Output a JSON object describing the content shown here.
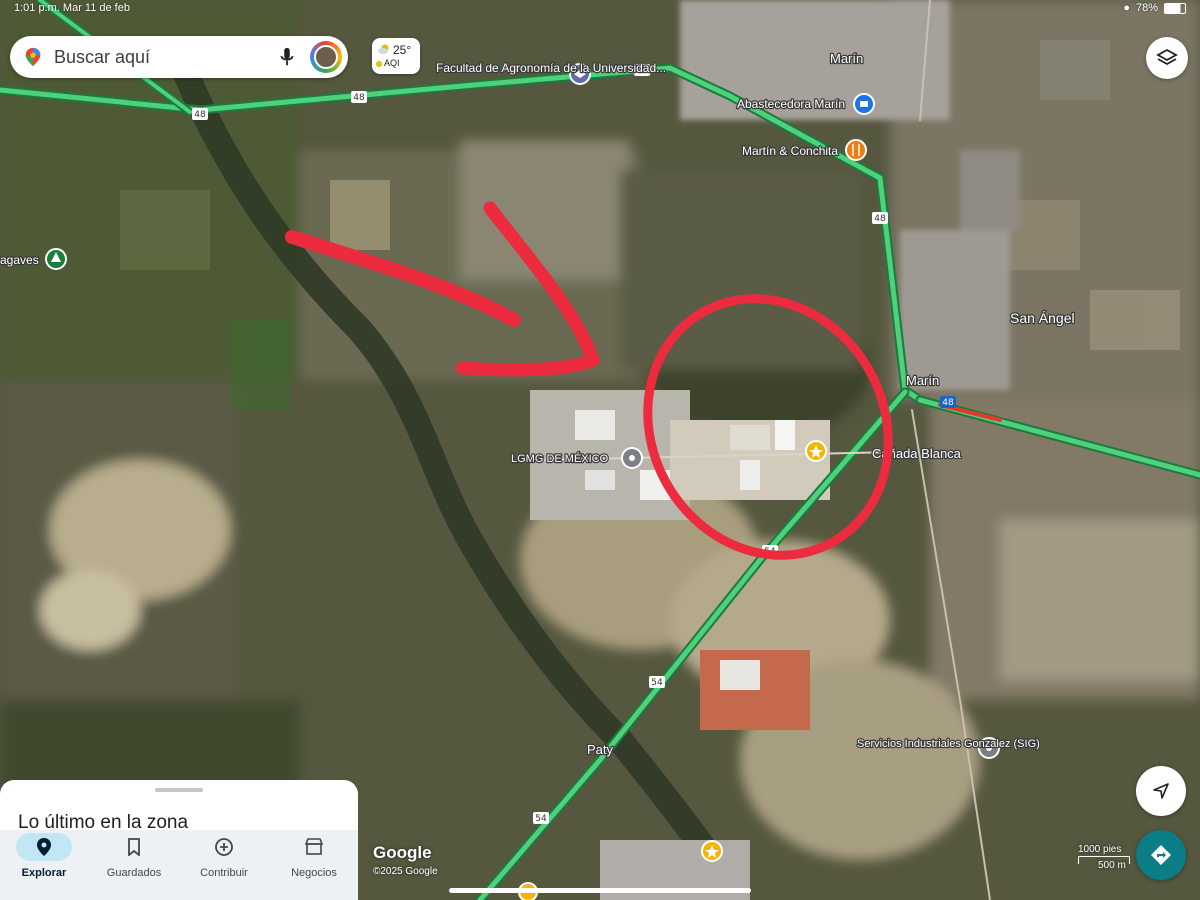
{
  "status_bar": {
    "time_date": "1:01 p.m.   Mar 11 de feb",
    "battery": "78%"
  },
  "search": {
    "placeholder": "Buscar aquí"
  },
  "weather": {
    "temp": "25°",
    "aqi_label": "AQI"
  },
  "map": {
    "places": [
      {
        "name": "Facultad de Agronomía de la Universidad...",
        "icon": "school-icon"
      },
      {
        "name": "Marín",
        "icon": ""
      },
      {
        "name": "Abastecedora Marín",
        "icon": "store-icon"
      },
      {
        "name": "Martín & Conchita",
        "icon": "restaurant-icon"
      },
      {
        "name": "agaves",
        "icon": "tree-icon"
      },
      {
        "name": "San Ángel",
        "icon": ""
      },
      {
        "name": "Marín",
        "icon": ""
      },
      {
        "name": "LGMG DE MÉXICO",
        "icon": "place-pin-icon"
      },
      {
        "name": "Cañada Blanca",
        "icon": ""
      },
      {
        "name": "Paty",
        "icon": ""
      },
      {
        "name": "Servicios Industriales Gonzalez (SIG)",
        "icon": "place-pin-icon"
      }
    ],
    "road_shields": [
      "48",
      "48",
      "48",
      "48",
      "48",
      "54",
      "54",
      "54"
    ],
    "annotations": [
      "red-arrow",
      "red-circle"
    ]
  },
  "bottom_sheet": {
    "title": "Lo último en la zona"
  },
  "bottom_nav": {
    "items": [
      {
        "label": "Explorar",
        "active": true,
        "icon": "explore-pin-icon"
      },
      {
        "label": "Guardados",
        "active": false,
        "icon": "bookmark-icon"
      },
      {
        "label": "Contribuir",
        "active": false,
        "icon": "add-circle-icon"
      },
      {
        "label": "Negocios",
        "active": false,
        "icon": "store-front-icon"
      }
    ]
  },
  "attribution": {
    "logo": "Google",
    "copyright": "©2025 Google"
  },
  "scale": {
    "feet": "1000 pies",
    "meters": "500 m"
  },
  "colors": {
    "traffic_green": "#3fbf6b",
    "annotation_red": "#ec2b3e",
    "directions_teal": "#0b7d87",
    "nav_active": "#c2e7f4"
  }
}
